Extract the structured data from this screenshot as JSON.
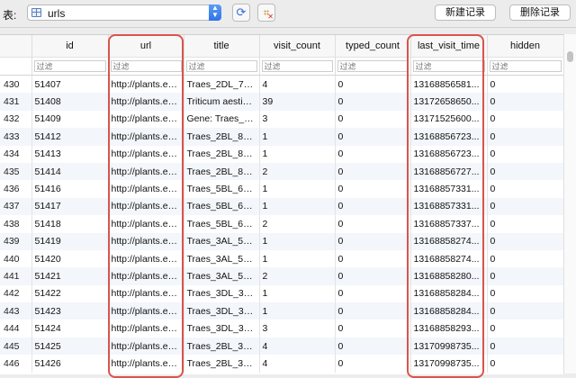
{
  "toolbar": {
    "table_label": "表:",
    "table_name": "urls",
    "new_record_label": "新建记录",
    "delete_record_label": "删除记录"
  },
  "grid": {
    "columns": [
      "",
      "id",
      "url",
      "title",
      "visit_count",
      "typed_count",
      "last_visit_time",
      "hidden"
    ],
    "filter_placeholder": "过滤",
    "rows": [
      [
        "430",
        "51407",
        "http://plants.en...",
        "Traes_2DL_70...",
        "4",
        "0",
        "13168856581...",
        "0"
      ],
      [
        "431",
        "51408",
        "http://plants.en...",
        "Triticum aestivu...",
        "39",
        "0",
        "13172658650...",
        "0"
      ],
      [
        "432",
        "51409",
        "http://plants.en...",
        "Gene: Traes_2D...",
        "3",
        "0",
        "13171525600...",
        "0"
      ],
      [
        "433",
        "51412",
        "http://plants.en...",
        "Traes_2BL_89...",
        "1",
        "0",
        "13168856723...",
        "0"
      ],
      [
        "434",
        "51413",
        "http://plants.en...",
        "Traes_2BL_89...",
        "1",
        "0",
        "13168856723...",
        "0"
      ],
      [
        "435",
        "51414",
        "http://plants.en...",
        "Traes_2BL_89...",
        "2",
        "0",
        "13168856727...",
        "0"
      ],
      [
        "436",
        "51416",
        "http://plants.en...",
        "Traes_5BL_6C7...",
        "1",
        "0",
        "13168857331...",
        "0"
      ],
      [
        "437",
        "51417",
        "http://plants.en...",
        "Traes_5BL_6C7...",
        "1",
        "0",
        "13168857331...",
        "0"
      ],
      [
        "438",
        "51418",
        "http://plants.en...",
        "Traes_5BL_6C7...",
        "2",
        "0",
        "13168857337...",
        "0"
      ],
      [
        "439",
        "51419",
        "http://plants.en...",
        "Traes_3AL_5F3...",
        "1",
        "0",
        "13168858274...",
        "0"
      ],
      [
        "440",
        "51420",
        "http://plants.en...",
        "Traes_3AL_5F3...",
        "1",
        "0",
        "13168858274...",
        "0"
      ],
      [
        "441",
        "51421",
        "http://plants.en...",
        "Traes_3AL_5F3...",
        "2",
        "0",
        "13168858280...",
        "0"
      ],
      [
        "442",
        "51422",
        "http://plants.en...",
        "Traes_3DL_32...",
        "1",
        "0",
        "13168858284...",
        "0"
      ],
      [
        "443",
        "51423",
        "http://plants.en...",
        "Traes_3DL_32...",
        "1",
        "0",
        "13168858284...",
        "0"
      ],
      [
        "444",
        "51424",
        "http://plants.en...",
        "Traes_3DL_32...",
        "3",
        "0",
        "13168858293...",
        "0"
      ],
      [
        "445",
        "51425",
        "http://plants.en...",
        "Traes_2BL_30...",
        "4",
        "0",
        "13170998735...",
        "0"
      ],
      [
        "446",
        "51426",
        "http://plants.en...",
        "Traes_2BL_30...",
        "4",
        "0",
        "13170998735...",
        "0"
      ]
    ]
  },
  "icons": {
    "refresh": "refresh-icon",
    "clear_filter": "clear-filter-icon",
    "table": "table-icon"
  },
  "colors": {
    "highlight": "#d9544d",
    "select_accent": "#2f73e8"
  }
}
